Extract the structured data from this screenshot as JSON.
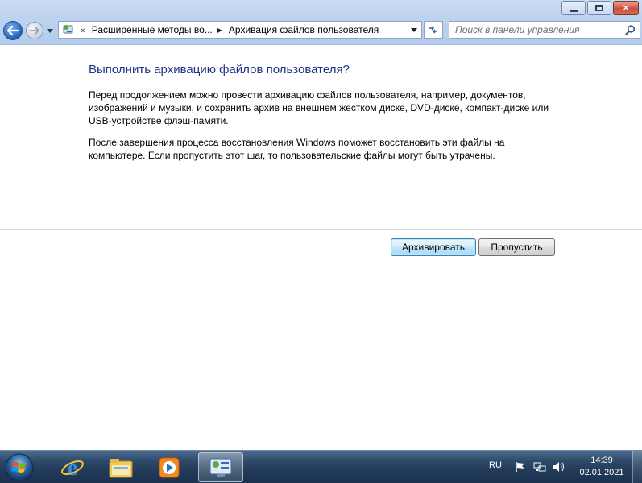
{
  "window": {
    "minimize_icon": "minimize-icon",
    "maximize_icon": "restore-icon",
    "close_icon": "close-icon"
  },
  "navbar": {
    "back_icon": "back-arrow-icon",
    "forward_icon": "forward-arrow-icon",
    "chevron": "«",
    "breadcrumbs": [
      {
        "label": "Расширенные методы во..."
      },
      {
        "label": "Архивация файлов пользователя"
      }
    ],
    "search_placeholder": "Поиск в панели управления"
  },
  "content": {
    "heading": "Выполнить архивацию файлов пользователя?",
    "paragraph1": "Перед продолжением можно провести архивацию файлов пользователя, например, документов, изображений и музыки, и сохранить архив на внешнем жестком диске, DVD-диске, компакт-диске или USB-устройстве флэш-памяти.",
    "paragraph2": "После завершения процесса восстановления Windows поможет восстановить эти файлы на компьютере. Если пропустить этот шаг, то пользовательские файлы могут быть утрачены.",
    "archive_button": "Архивировать",
    "skip_button": "Пропустить"
  },
  "taskbar": {
    "items": [
      {
        "icon": "internet-explorer-icon"
      },
      {
        "icon": "windows-explorer-icon"
      },
      {
        "icon": "media-player-icon"
      },
      {
        "icon": "control-panel-icon",
        "active": true
      }
    ],
    "language": "RU",
    "time": "14:39",
    "date": "02.01.2021"
  },
  "colors": {
    "heading": "#1e3287",
    "taskbar": "#223b58",
    "chrome": "#bdd3ee"
  }
}
